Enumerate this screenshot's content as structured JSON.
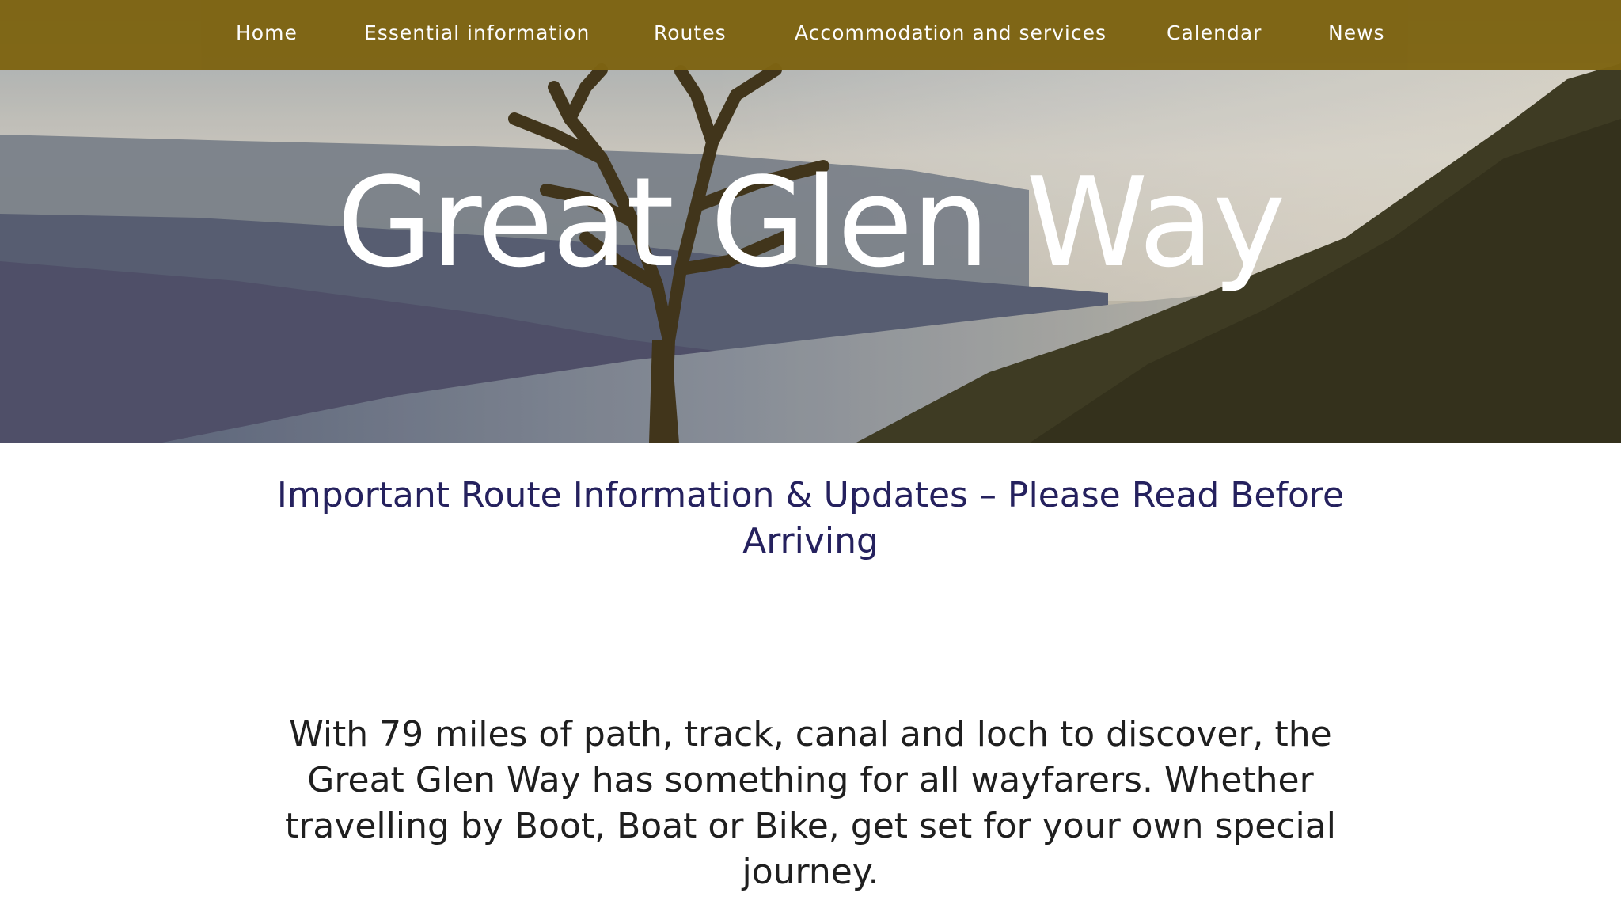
{
  "nav": {
    "items": [
      {
        "label": "Home"
      },
      {
        "label": "Essential information"
      },
      {
        "label": "Routes"
      },
      {
        "label": "Accommodation and services"
      },
      {
        "label": "Calendar"
      },
      {
        "label": "News"
      }
    ]
  },
  "hero": {
    "title": "Great Glen Way"
  },
  "main": {
    "notice_link": "Important Route Information & Updates – Please Read Before Arriving",
    "intro_text": "With 79 miles of path, track, canal and loch to discover, the Great Glen Way has something for all wayfarers. Whether travelling by Boot, Boat or Bike, get set for your own special journey."
  },
  "colors": {
    "nav_background": "#7e6412",
    "notice_link": "#25215e",
    "body_text": "#1f1f1f"
  }
}
